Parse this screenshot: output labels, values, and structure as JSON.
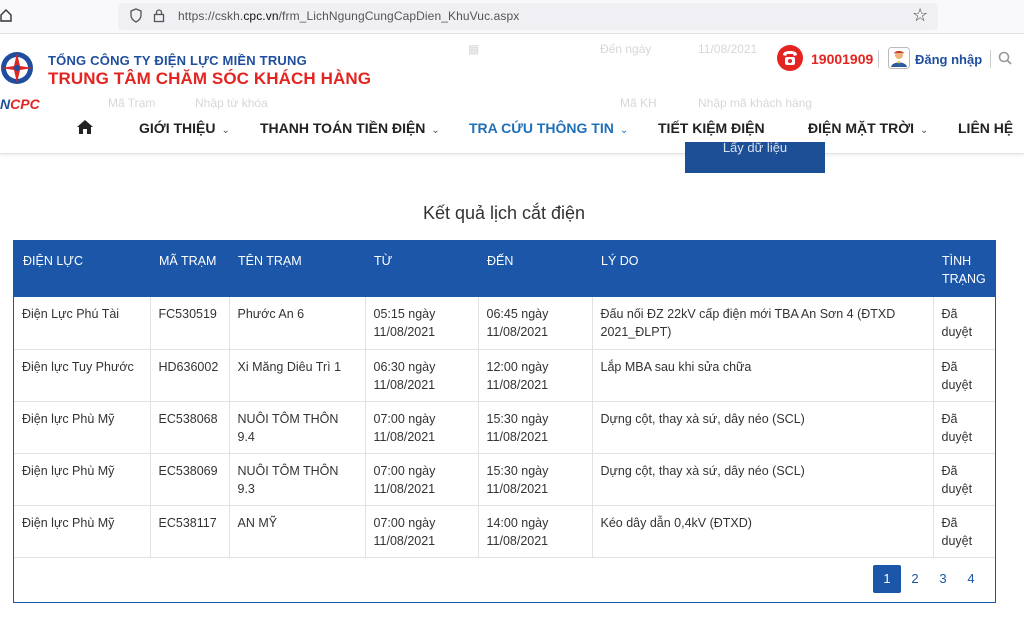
{
  "browser": {
    "url_prefix": "https://cskh.",
    "url_domain": "cpc.vn",
    "url_path": "/frm_LichNgungCungCapDien_KhuVuc.aspx"
  },
  "header": {
    "logo_prefix": "N",
    "logo_suffix": "CPC",
    "company": "TỔNG CÔNG TY ĐIỆN LỰC MIỀN TRUNG",
    "center": "TRUNG TÂM CHĂM SÓC KHÁCH HÀNG",
    "hotline": "19001909",
    "login": "Đăng nhập",
    "ghost_from": "Đến ngày",
    "ghost_date": "11/08/2021",
    "ghost_ma": "Mã Trạm",
    "ghost_kw": "Nhập từ khóa",
    "ghost_ma2": "Mã KH",
    "ghost_kw2": "Nhập mã khách hàng"
  },
  "nav": {
    "items": [
      "GIỚI THIỆU",
      "THANH TOÁN TIỀN ĐIỆN",
      "TRA CỨU THÔNG TIN",
      "TIẾT KIỆM ĐIỆN",
      "ĐIỆN MẶT TRỜI",
      "LIÊN HỆ"
    ]
  },
  "fetch_button": "Lấy dữ liệu",
  "result_title": "Kết quả lịch cắt điện",
  "table": {
    "headers": [
      "ĐIỆN LỰC",
      "MÃ TRẠM",
      "TÊN TRẠM",
      "TỪ",
      "ĐẾN",
      "LÝ DO",
      "TÌNH TRẠNG"
    ],
    "rows": [
      {
        "dl": "Điện Lực Phú Tài",
        "ma": "FC530519",
        "ten": "Phước An 6",
        "tu": "05:15 ngày 11/08/2021",
        "den": "06:45 ngày 11/08/2021",
        "lydo": "Đấu nối ĐZ 22kV cấp điện mới TBA An Sơn 4 (ĐTXD 2021_ĐLPT)",
        "tt": "Đã duyệt"
      },
      {
        "dl": "Điện lực Tuy Phước",
        "ma": "HD636002",
        "ten": "Xi Măng Diêu Trì 1",
        "tu": "06:30 ngày 11/08/2021",
        "den": "12:00 ngày 11/08/2021",
        "lydo": "Lắp MBA sau khi sửa chữa",
        "tt": "Đã duyệt"
      },
      {
        "dl": "Điện lực Phù Mỹ",
        "ma": "EC538068",
        "ten": "NUÔI TÔM THÔN 9.4",
        "tu": "07:00 ngày 11/08/2021",
        "den": "15:30 ngày 11/08/2021",
        "lydo": "Dựng cột, thay xà sứ, dây néo (SCL)",
        "tt": "Đã duyệt"
      },
      {
        "dl": "Điện lực Phù Mỹ",
        "ma": "EC538069",
        "ten": "NUÔI TÔM THÔN 9.3",
        "tu": "07:00 ngày 11/08/2021",
        "den": "15:30 ngày 11/08/2021",
        "lydo": "Dựng cột, thay xà sứ, dây néo (SCL)",
        "tt": "Đã duyệt"
      },
      {
        "dl": "Điện lực Phù Mỹ",
        "ma": "EC538117",
        "ten": "AN MỸ",
        "tu": "07:00 ngày 11/08/2021",
        "den": "14:00 ngày 11/08/2021",
        "lydo": "Kéo dây dẫn 0,4kV (ĐTXD)",
        "tt": "Đã duyệt"
      }
    ]
  },
  "pager": {
    "pages": [
      "1",
      "2",
      "3",
      "4"
    ],
    "active": "1"
  }
}
